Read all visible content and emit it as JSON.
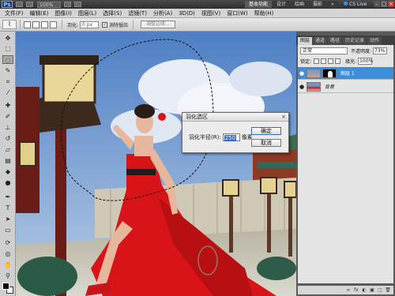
{
  "titlebar": {
    "app_logo": "Ps",
    "zoom": "100%",
    "workspaces": [
      "基本功能",
      "设计",
      "绘画",
      "摄影"
    ],
    "more": "»",
    "cs_live": "CS Live",
    "win_min": "–",
    "win_max": "□",
    "win_close": "×"
  },
  "menubar": {
    "items": [
      "文件(F)",
      "编辑(E)",
      "图像(I)",
      "图层(L)",
      "选择(S)",
      "滤镜(T)",
      "分析(A)",
      "3D(D)",
      "视图(V)",
      "窗口(W)",
      "帮助(H)"
    ]
  },
  "options": {
    "feather_label": "羽化:",
    "feather_value": "0 px",
    "antialias_label": "消除锯齿",
    "antialias_checked": "✓",
    "refine_edge_label": "调整边缘..."
  },
  "dialog": {
    "title": "羽化选区",
    "close": "×",
    "radius_label": "羽化半径(R):",
    "radius_value": "250",
    "unit": "像素",
    "ok_label": "确定",
    "cancel_label": "取消"
  },
  "panel": {
    "tabs": [
      "图层",
      "通道",
      "路径",
      "历史记录",
      "动作"
    ],
    "blend_mode": "正常",
    "opacity_label": "不透明度:",
    "opacity_value": "73%",
    "lock_label": "锁定:",
    "fill_label": "填充:",
    "fill_value": "100%",
    "layers": [
      {
        "name": "图层 1",
        "visible": "●",
        "selected": true
      },
      {
        "name": "背景",
        "visible": "●",
        "selected": false
      }
    ],
    "footer_icons": [
      "∞",
      "fx",
      "◐",
      "▣",
      "▢",
      "🗑"
    ]
  },
  "colors": {
    "accent": "#3c8ddc",
    "dress_red": "#d81418",
    "sky": "#7aa0cf"
  }
}
